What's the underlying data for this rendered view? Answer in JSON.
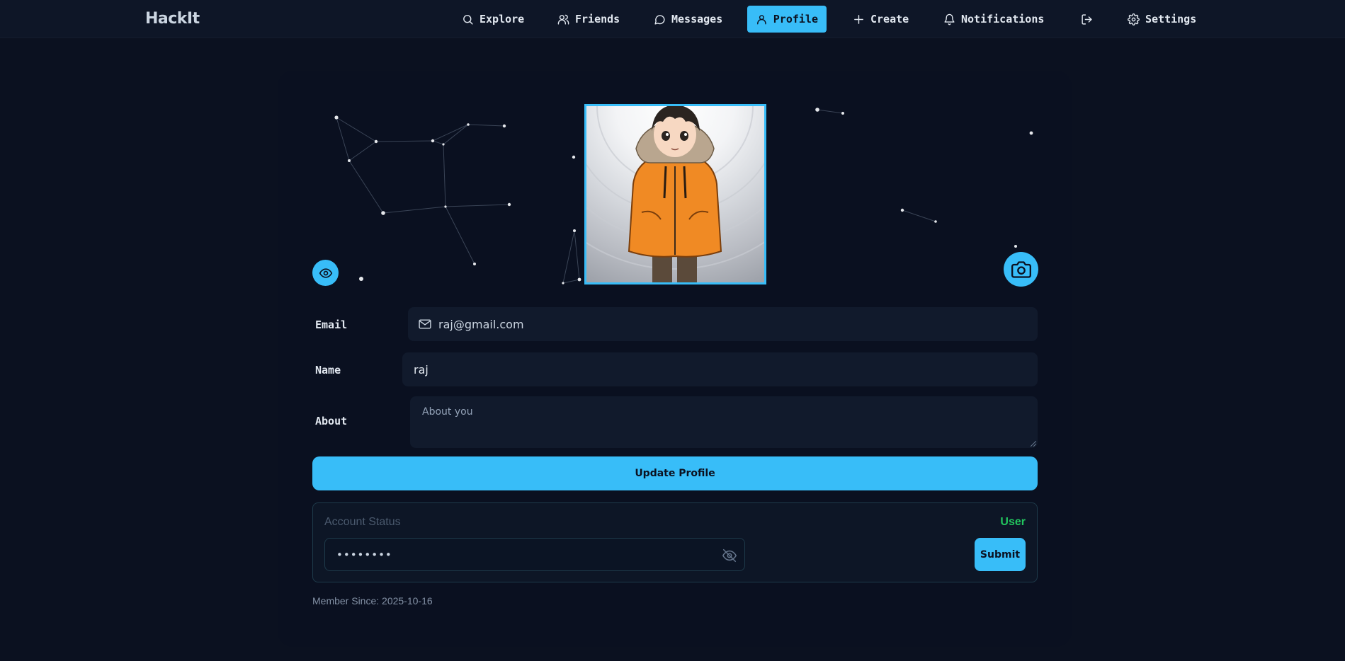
{
  "brand": "HackIt",
  "nav": {
    "explore": "Explore",
    "friends": "Friends",
    "messages": "Messages",
    "profile": "Profile",
    "create": "Create",
    "notifications": "Notifications",
    "settings": "Settings"
  },
  "nav_icons": [
    "search-icon",
    "friends-icon",
    "message-icon",
    "user-icon",
    "plus-icon",
    "bell-icon",
    "logout-icon",
    "gear-icon"
  ],
  "active_tab": "Profile",
  "colors": {
    "accent": "#38bdf8",
    "background": "#0b1120",
    "status_green": "#22c55e"
  },
  "profile": {
    "email_label": "Email",
    "email_value": "raj@gmail.com",
    "name_label": "Name",
    "name_value": "raj",
    "about_label": "About",
    "about_placeholder": "About you",
    "update_button": "Update Profile"
  },
  "account": {
    "status_title": "Account Status",
    "role": "User",
    "password_mask": "••••••••",
    "submit_button": "Submit"
  },
  "member_since": "Member Since: 2025-10-16"
}
